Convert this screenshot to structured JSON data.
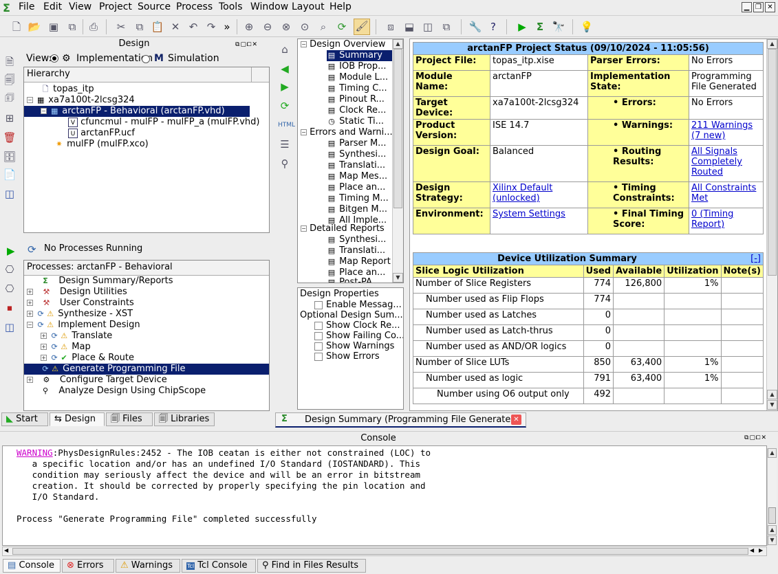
{
  "menu": [
    "File",
    "Edit",
    "View",
    "Project",
    "Source",
    "Process",
    "Tools",
    "Window",
    "Layout",
    "Help"
  ],
  "design_panel": {
    "title": "Design",
    "view_label": "View:",
    "impl": "Implementation",
    "sim": "Simulation",
    "hierarchy_title": "Hierarchy",
    "tree": [
      "topas_itp",
      "xa7a100t-2lcsg324",
      "arctanFP - Behavioral (arctanFP.vhd)",
      "cfuncmul - mulFP - mulFP_a (mulFP.vhd)",
      "arctanFP.ucf",
      "mulFP (mulFP.xco)"
    ],
    "no_proc": "No Processes Running",
    "proc_title": "Processes: arctanFP - Behavioral",
    "processes": [
      "Design Summary/Reports",
      "Design Utilities",
      "User Constraints",
      "Synthesize - XST",
      "Implement Design",
      "Translate",
      "Map",
      "Place & Route",
      "Generate Programming File",
      "Configure Target Device",
      "Analyze Design Using ChipScope"
    ]
  },
  "tabs_left": [
    "Start",
    "Design",
    "Files",
    "Libraries"
  ],
  "overview": {
    "items": [
      "Design Overview",
      "Summary",
      "IOB Prop...",
      "Module L...",
      "Timing C...",
      "Pinout R...",
      "Clock Re...",
      "Static Ti...",
      "Errors and Warni...",
      "Parser M...",
      "Synthesi...",
      "Translati...",
      "Map Mes...",
      "Place an...",
      "Timing M...",
      "Bitgen M...",
      "All Imple...",
      "Detailed Reports",
      "Synthesi...",
      "Translati...",
      "Map Report",
      "Place an...",
      "Post-PA..."
    ],
    "props_title": "Design Properties",
    "enable_msg": "Enable Messag...",
    "opt_title": "Optional Design Sum...",
    "opts": [
      "Show Clock Re...",
      "Show Failing Co...",
      "Show Warnings",
      "Show Errors"
    ]
  },
  "status": {
    "title": "arctanFP Project Status (09/10/2024 - 11:05:56)",
    "rows": [
      [
        "Project File:",
        "topas_itp.xise",
        "Parser Errors:",
        "No Errors"
      ],
      [
        "Module Name:",
        "arctanFP",
        "Implementation State:",
        "Programming File Generated"
      ],
      [
        "Target Device:",
        "xa7a100t-2lcsg324",
        "Errors:",
        "No Errors"
      ],
      [
        "Product Version:",
        "ISE 14.7",
        "Warnings:",
        "211 Warnings (7 new)"
      ],
      [
        "Design Goal:",
        "Balanced",
        "Routing Results:",
        "All Signals Completely Routed"
      ],
      [
        "Design Strategy:",
        "Xilinx Default (unlocked)",
        "Timing Constraints:",
        "All Constraints Met"
      ],
      [
        "Environment:",
        "System Settings",
        "Final Timing Score:",
        "0 (Timing Report)"
      ]
    ]
  },
  "util": {
    "title": "Device Utilization Summary",
    "collapse": "[-]",
    "headers": [
      "Slice Logic Utilization",
      "Used",
      "Available",
      "Utilization",
      "Note(s)"
    ],
    "rows": [
      [
        "Number of Slice Registers",
        "774",
        "126,800",
        "1%",
        ""
      ],
      [
        "Number used as Flip Flops",
        "774",
        "",
        "",
        ""
      ],
      [
        "Number used as Latches",
        "0",
        "",
        "",
        ""
      ],
      [
        "Number used as Latch-thrus",
        "0",
        "",
        "",
        ""
      ],
      [
        "Number used as AND/OR logics",
        "0",
        "",
        "",
        ""
      ],
      [
        "Number of Slice LUTs",
        "850",
        "63,400",
        "1%",
        ""
      ],
      [
        "Number used as logic",
        "791",
        "63,400",
        "1%",
        ""
      ],
      [
        "Number using O6 output only",
        "492",
        "",
        "",
        ""
      ]
    ]
  },
  "doc_tab": "Design Summary (Programming File Generated)",
  "console": {
    "title": "Console",
    "warn": "WARNING",
    "lines": [
      ":PhysDesignRules:2452 - The IOB ceatan is either not constrained (LOC) to",
      "   a specific location and/or has an undefined I/O Standard (IOSTANDARD). This",
      "   condition may seriously affect the device and will be an error in bitstream",
      "   creation. It should be corrected by properly specifying the pin location and",
      "   I/O Standard.",
      "",
      "Process \"Generate Programming File\" completed successfully"
    ]
  },
  "bottom_tabs": [
    "Console",
    "Errors",
    "Warnings",
    "Tcl Console",
    "Find in Files Results"
  ]
}
